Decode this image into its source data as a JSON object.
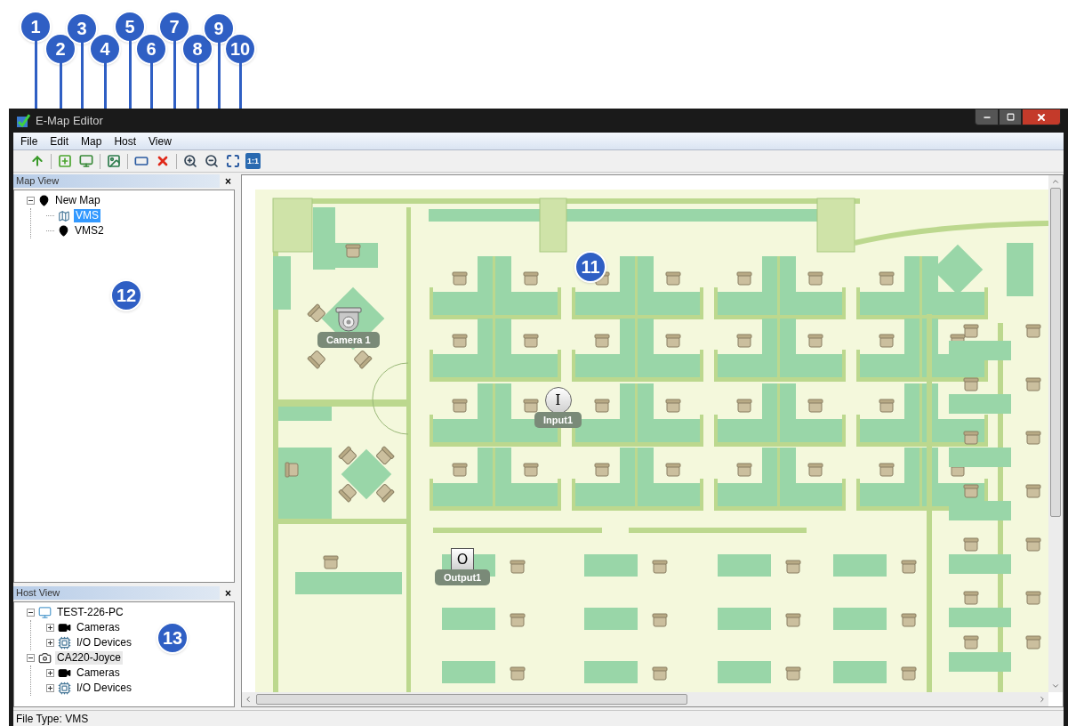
{
  "callouts": [
    {
      "label": "1"
    },
    {
      "label": "2"
    },
    {
      "label": "3"
    },
    {
      "label": "4"
    },
    {
      "label": "5"
    },
    {
      "label": "6"
    },
    {
      "label": "7"
    },
    {
      "label": "8"
    },
    {
      "label": "9"
    },
    {
      "label": "10"
    }
  ],
  "window": {
    "title": "E-Map Editor"
  },
  "menu": [
    "File",
    "Edit",
    "Map",
    "Host",
    "View"
  ],
  "toolbar": [
    {
      "kind": "up"
    },
    {
      "kind": "add-map"
    },
    {
      "kind": "add-host"
    },
    {
      "kind": "image"
    },
    {
      "kind": "rename"
    },
    {
      "kind": "delete"
    },
    {
      "kind": "zoom-in"
    },
    {
      "kind": "zoom-out"
    },
    {
      "kind": "fit"
    },
    {
      "kind": "actual-size",
      "label": "1:1"
    }
  ],
  "map_view": {
    "title": "Map View",
    "close": "×",
    "callout": "12",
    "tree": [
      {
        "label": "New Map",
        "kind": "pin",
        "expanded": true,
        "selected": false,
        "children": [
          {
            "label": "VMS",
            "kind": "map",
            "selected": true
          },
          {
            "label": "VMS2",
            "kind": "pin",
            "selected": false
          }
        ]
      }
    ]
  },
  "host_view": {
    "title": "Host View",
    "close": "×",
    "callout": "13",
    "tree": [
      {
        "label": "TEST-226-PC",
        "kind": "computer",
        "expanded": true,
        "selected": false,
        "children": [
          {
            "label": "Cameras",
            "kind": "camera",
            "expanded": false,
            "selected": false
          },
          {
            "label": "I/O Devices",
            "kind": "io",
            "expanded": false,
            "selected": false
          }
        ]
      },
      {
        "label": "CA220-Joyce",
        "kind": "device",
        "expanded": true,
        "selected": true,
        "children": [
          {
            "label": "Cameras",
            "kind": "camera",
            "expanded": false,
            "selected": false
          },
          {
            "label": "I/O Devices",
            "kind": "io",
            "expanded": false,
            "selected": false
          }
        ]
      }
    ]
  },
  "map": {
    "callout": "11",
    "markers": [
      {
        "kind": "camera",
        "label": "Camera 1"
      },
      {
        "kind": "input",
        "symbol": "I",
        "label": "Input1"
      },
      {
        "kind": "output",
        "symbol": "O",
        "label": "Output1"
      }
    ]
  },
  "status_bar": {
    "text": "File Type: VMS"
  }
}
